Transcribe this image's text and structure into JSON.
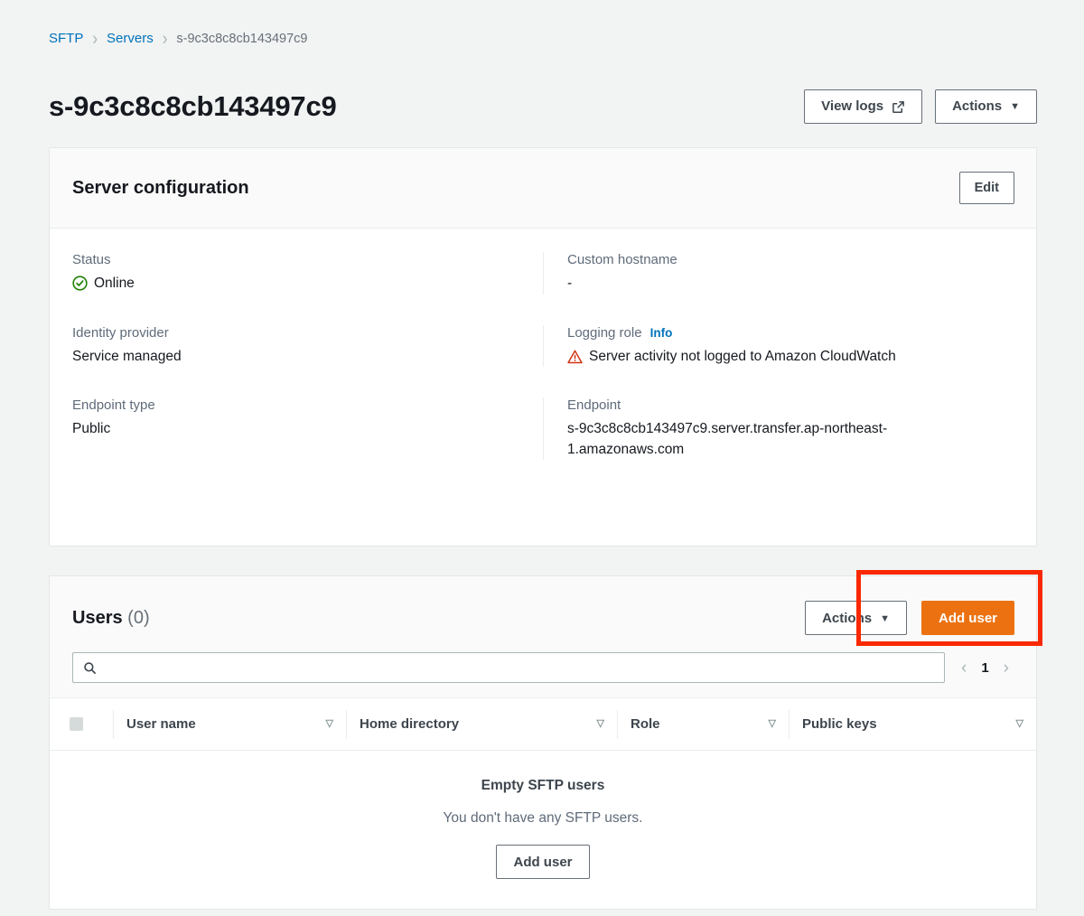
{
  "breadcrumb": {
    "items": [
      {
        "label": "SFTP",
        "type": "link"
      },
      {
        "label": "Servers",
        "type": "link"
      },
      {
        "label": "s-9c3c8c8cb143497c9",
        "type": "current"
      }
    ],
    "separator": "›"
  },
  "header": {
    "title": "s-9c3c8c8cb143497c9",
    "view_logs_label": "View logs",
    "view_logs_icon": "external-link-icon",
    "actions_label": "Actions",
    "actions_caret": "▼"
  },
  "server_configuration": {
    "title": "Server configuration",
    "edit_label": "Edit",
    "fields": [
      {
        "label": "Status",
        "value": "Online",
        "icon": "status-online-check-icon",
        "icon_color": "#1d8102"
      },
      {
        "label": "Custom hostname",
        "value": "-"
      },
      {
        "label": "Identity provider",
        "value": "Service managed"
      },
      {
        "label": "Logging role",
        "info_label": "Info",
        "value": "Server activity not logged to Amazon CloudWatch",
        "icon": "warning-triangle-icon",
        "icon_color": "#d13212"
      },
      {
        "label": "Endpoint type",
        "value": "Public"
      },
      {
        "label": "Endpoint",
        "value": "s-9c3c8c8cb143497c9.server.transfer.ap-northeast-1.amazonaws.com"
      }
    ]
  },
  "users": {
    "title": "Users",
    "count_label": "(0)",
    "actions_label": "Actions",
    "actions_caret": "▼",
    "add_user_label": "Add user",
    "search": {
      "placeholder": "",
      "value": "",
      "icon": "search-icon"
    },
    "pagination": {
      "prev_icon": "‹",
      "page": "1",
      "next_icon": "›"
    },
    "columns": [
      {
        "label": "User name",
        "sort_icon": "▽"
      },
      {
        "label": "Home directory",
        "sort_icon": "▽"
      },
      {
        "label": "Role",
        "sort_icon": "▽"
      },
      {
        "label": "Public keys",
        "sort_icon": "▽"
      }
    ],
    "empty_state": {
      "title": "Empty SFTP users",
      "subtitle": "You don't have any SFTP users.",
      "button_label": "Add user"
    }
  },
  "annotation": {
    "highlight_color": "#fa2800",
    "target": "add-user-button"
  }
}
